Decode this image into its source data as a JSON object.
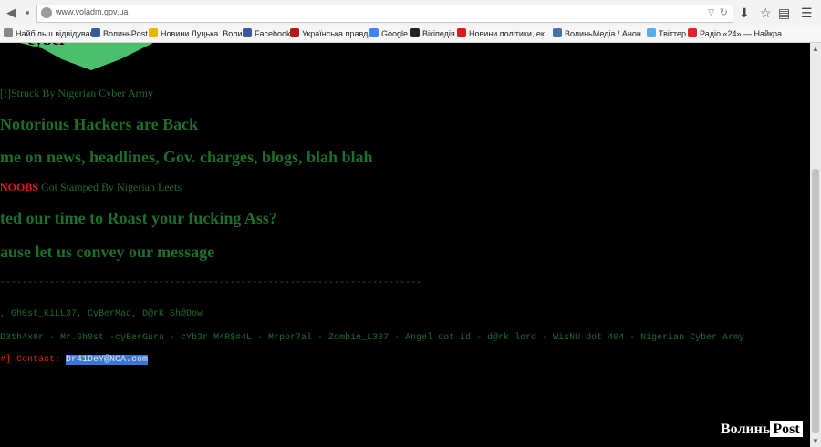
{
  "browser": {
    "url": "www.voladm.gov.ua",
    "bookmarks": [
      {
        "label": "Найбільш відвідувані",
        "icon_color": "#888888"
      },
      {
        "label": "ВолиньPost",
        "icon_color": "#3a5a9a"
      },
      {
        "label": "Новини Луцька. Воли...",
        "icon_color": "#e8b400"
      },
      {
        "label": "Facebook",
        "icon_color": "#3b5998"
      },
      {
        "label": "Українська правда",
        "icon_color": "#b01c1c"
      },
      {
        "label": "Google",
        "icon_color": "#4285f4"
      },
      {
        "label": "Вікіпедія",
        "icon_color": "#222222"
      },
      {
        "label": "Новини політики, ек...",
        "icon_color": "#d11e1e"
      },
      {
        "label": "ВолиньМедіа / Анон...",
        "icon_color": "#4a6fa5"
      },
      {
        "label": "Твіттер",
        "icon_color": "#55acee"
      },
      {
        "label": "Радіо «24» — Найкра...",
        "icon_color": "#d62b2b"
      }
    ]
  },
  "page": {
    "line1": "[!]Struck By Nigerian Cyber Army",
    "heading1": "Notorious Hackers are Back",
    "heading2": "me on news, headlines, Gov. charges, blogs, blah blah",
    "line4_red": "NOOBS",
    "line4_rest": "Got Stamped By Nigerian Leets",
    "heading3": "ted our time to Roast your fucking Ass?",
    "heading4": "ause let us convey our message",
    "separator": "-----------------------------------------------------------------------------",
    "credits1": ", Gh0st_KiLL37,  CyBerMad, D@rK Sh@Dow",
    "credits2": "D3th4x0r - Mr.Gh0st -cyBerGuru - cYb3r M4R$#4L - Mrpor7al - Zombie_L337 -  Angel dot id - d@rk lord - WisNU dot 404 - Nigerian Cyber Army",
    "contact_label": "#] Contact:",
    "contact_value": "Dr41DeY@NCA.com",
    "logo_color": "#4bbf6b"
  },
  "watermark": {
    "left": "Волинь",
    "right": "Post"
  }
}
